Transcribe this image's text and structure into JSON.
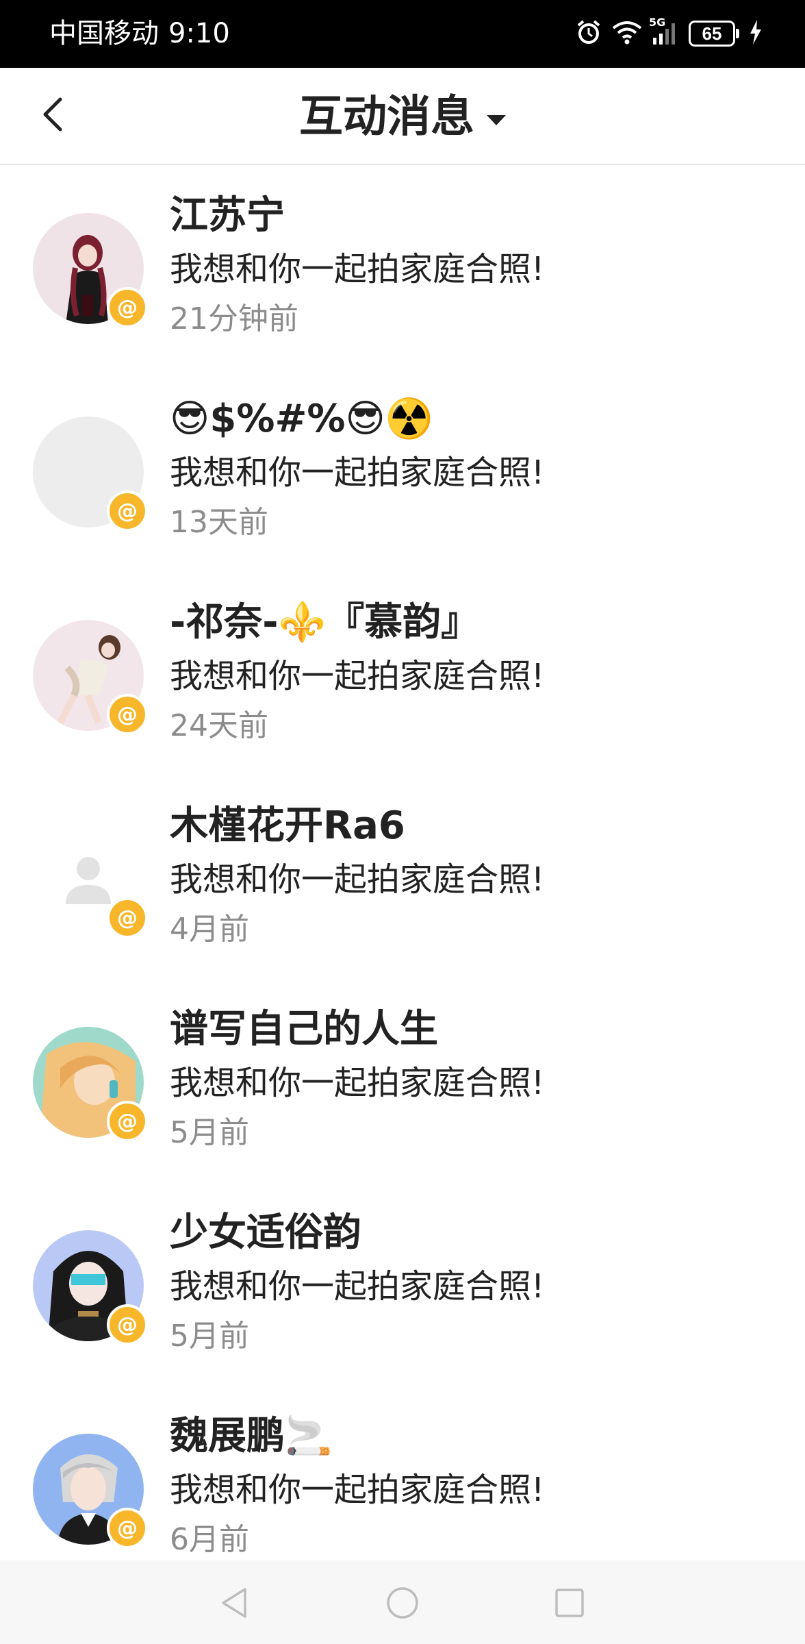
{
  "status_bar": {
    "carrier": "中国移动",
    "time": "9:10",
    "network": "5G",
    "battery": "65"
  },
  "header": {
    "title": "互动消息"
  },
  "messages": [
    {
      "name": "江苏宁",
      "text": "我想和你一起拍家庭合照!",
      "time": "21分钟前",
      "avatar": "anime-girl-red-avatar"
    },
    {
      "name": "😎$%#%😎☢️",
      "text": "我想和你一起拍家庭合照!",
      "time": "13天前",
      "avatar": "blank-avatar"
    },
    {
      "name": "-祁奈-⚜️『慕韵』",
      "text": "我想和你一起拍家庭合照!",
      "time": "24天前",
      "avatar": "anime-girl-sitting-avatar"
    },
    {
      "name": "木槿花开Ra6",
      "text": "我想和你一起拍家庭合照!",
      "time": "4月前",
      "avatar": "default-person-avatar"
    },
    {
      "name": "谱写自己的人生",
      "text": "我想和你一起拍家庭合照!",
      "time": "5月前",
      "avatar": "anime-golden-hair-avatar"
    },
    {
      "name": "少女适俗韵",
      "text": "我想和你一起拍家庭合照!",
      "time": "5月前",
      "avatar": "anime-girl-black-hair-avatar"
    },
    {
      "name": "魏展鹏🚬",
      "text": "我想和你一起拍家庭合照!",
      "time": "6月前",
      "avatar": "anime-silver-hair-avatar"
    }
  ],
  "badge_symbol": "@",
  "colors": {
    "badge": "#f8b62a",
    "time_text": "#8c8c8c",
    "title_text": "#222222"
  }
}
